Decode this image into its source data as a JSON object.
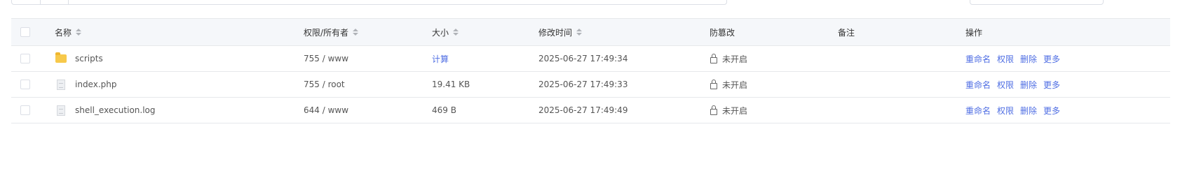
{
  "columns": {
    "name": "名称",
    "perm_owner": "权限/所有者",
    "size": "大小",
    "mtime": "修改时间",
    "tamper": "防篡改",
    "note": "备注",
    "ops": "操作"
  },
  "rows": [
    {
      "icon": "folder-icon",
      "name": "scripts",
      "perm_owner": "755 / www",
      "size": "计算",
      "mtime": "2025-06-27 17:49:34",
      "tamper": "未开启",
      "note": "",
      "ops": [
        "重命名",
        "权限",
        "删除",
        "更多"
      ]
    },
    {
      "icon": "file-icon",
      "name": "index.php",
      "perm_owner": "755 / root",
      "size": "19.41 KB",
      "mtime": "2025-06-27 17:49:33",
      "tamper": "未开启",
      "note": "",
      "ops": [
        "重命名",
        "权限",
        "删除",
        "更多"
      ]
    },
    {
      "icon": "file-icon",
      "name": "shell_execution.log",
      "perm_owner": "644 / www",
      "size": "469 B",
      "mtime": "2025-06-27 17:49:49",
      "tamper": "未开启",
      "note": "",
      "ops": [
        "重命名",
        "权限",
        "删除",
        "更多"
      ]
    }
  ],
  "colors": {
    "link": "#4f6ee3",
    "header_bg": "#f5f7fa",
    "border": "#e6e8eb",
    "folder": "#f7c94b"
  }
}
